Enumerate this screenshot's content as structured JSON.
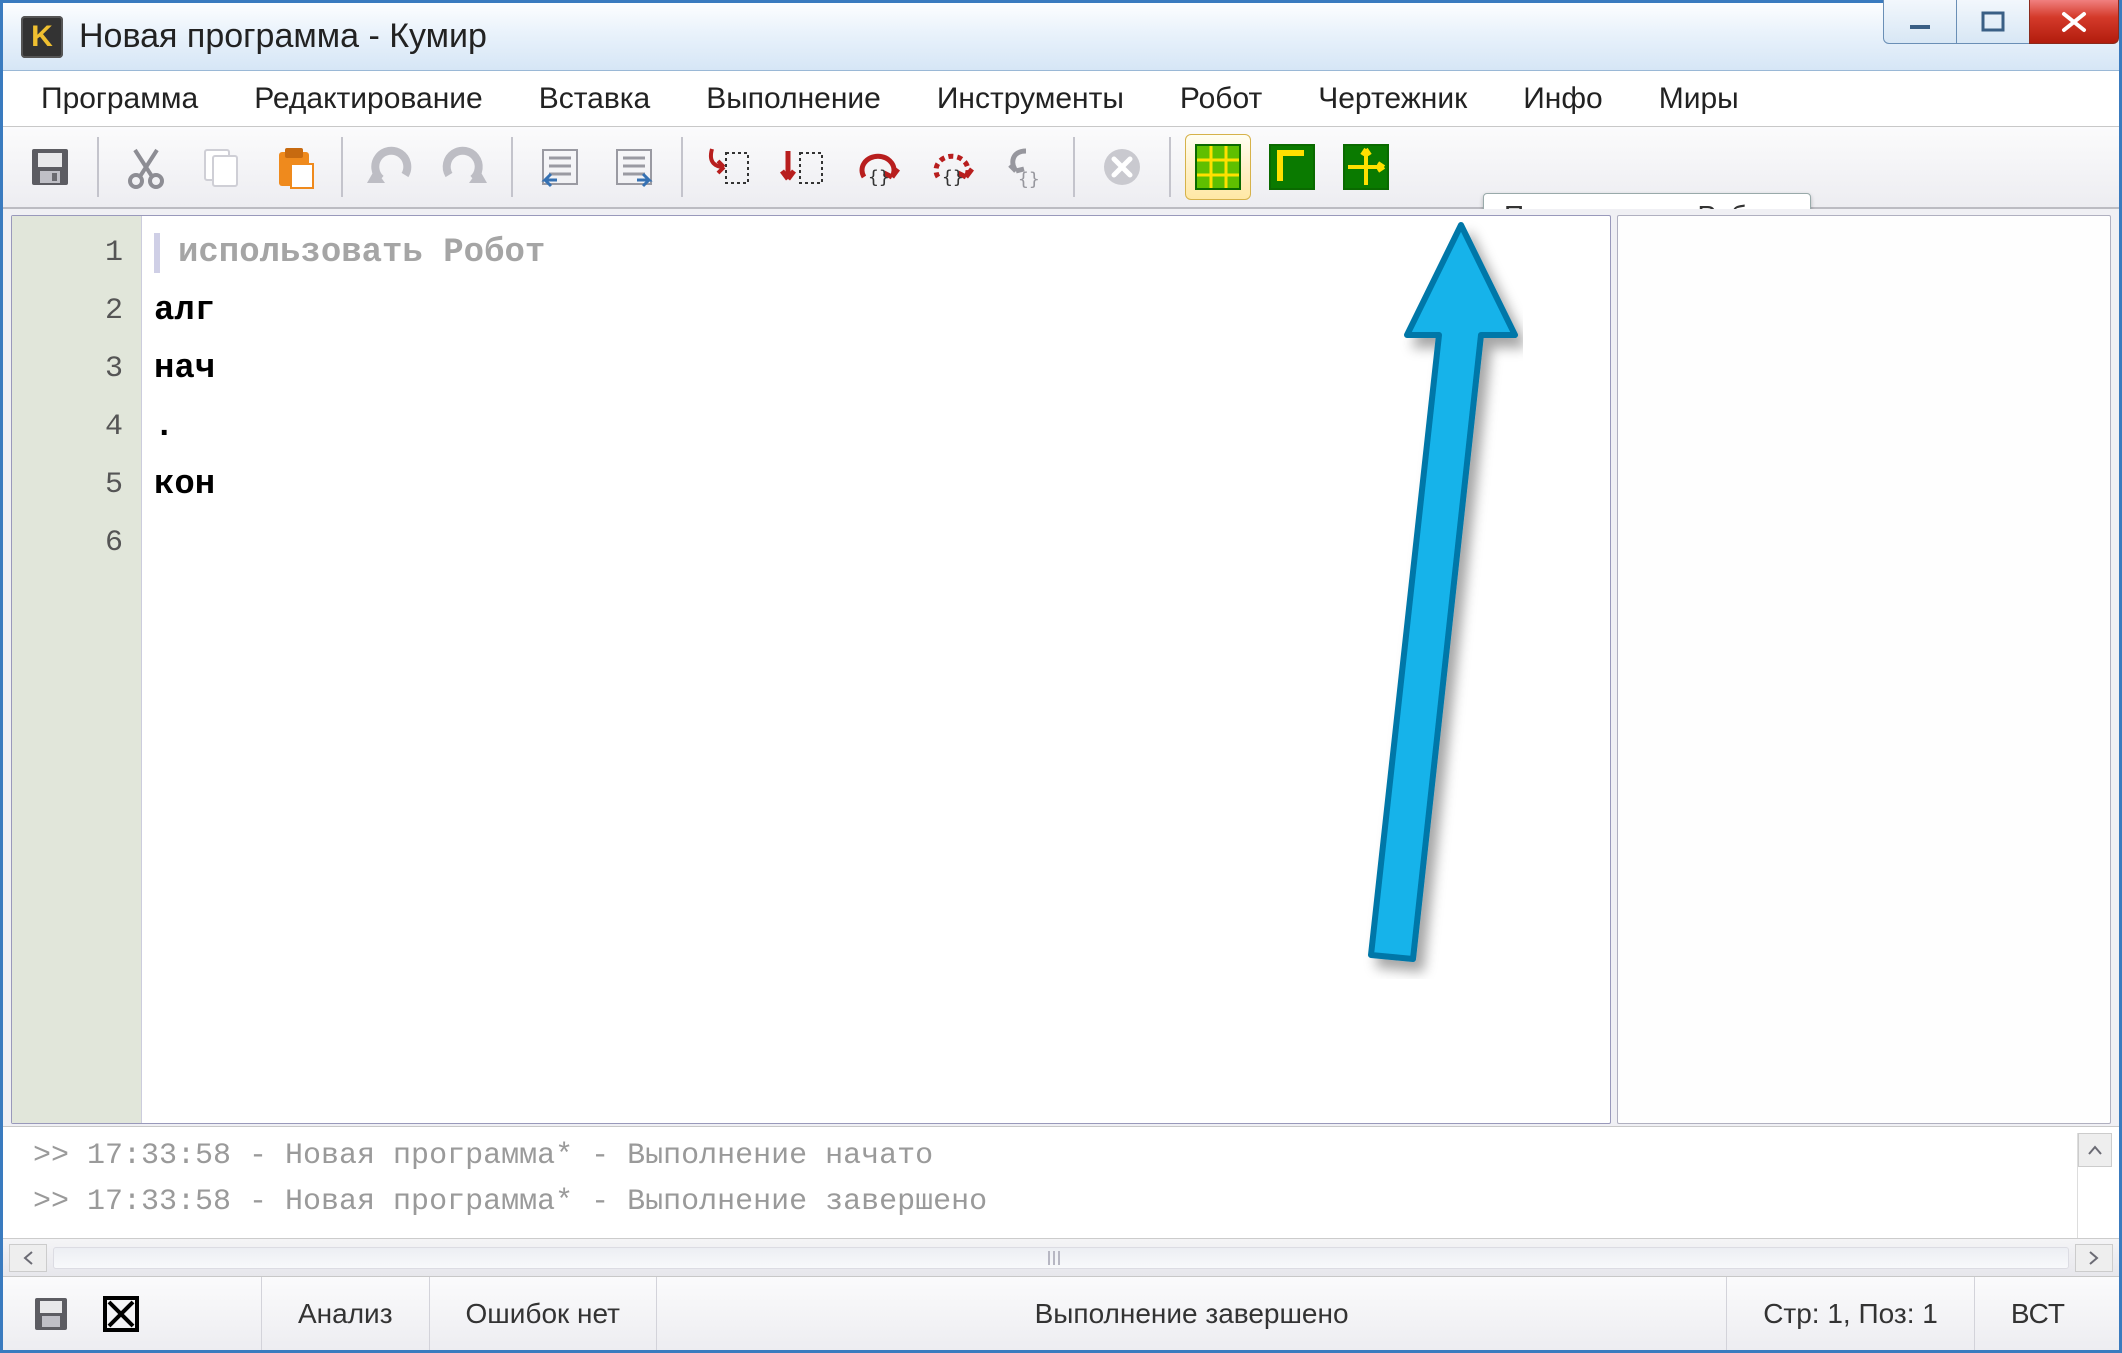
{
  "titlebar": {
    "title": "Новая программа - Кумир",
    "app_badge": "K"
  },
  "menu": {
    "items": [
      "Программа",
      "Редактирование",
      "Вставка",
      "Выполнение",
      "Инструменты",
      "Робот",
      "Чертежник",
      "Инфо",
      "Миры"
    ]
  },
  "toolbar": {
    "buttons": [
      {
        "name": "save-icon"
      },
      {
        "sep": true
      },
      {
        "name": "cut-icon"
      },
      {
        "name": "copy-icon"
      },
      {
        "name": "paste-icon"
      },
      {
        "sep": true
      },
      {
        "name": "undo-icon"
      },
      {
        "name": "redo-icon"
      },
      {
        "sep": true
      },
      {
        "name": "indent-left-icon"
      },
      {
        "name": "indent-right-icon"
      },
      {
        "sep": true
      },
      {
        "name": "run-step-into-icon"
      },
      {
        "name": "run-step-over-icon"
      },
      {
        "name": "run-block-icon"
      },
      {
        "name": "run-small-step-icon"
      },
      {
        "name": "run-to-end-icon"
      },
      {
        "sep": true
      },
      {
        "name": "stop-icon"
      },
      {
        "sep": true
      },
      {
        "name": "show-robot-grid-icon"
      },
      {
        "name": "show-drafter-icon"
      },
      {
        "name": "show-axes-icon"
      }
    ]
  },
  "tooltip": {
    "text": "Показать окно Робота"
  },
  "editor": {
    "lines": [
      {
        "n": "1",
        "type": "comment",
        "text": "использовать Робот"
      },
      {
        "n": "2",
        "type": "kw",
        "text": "алг"
      },
      {
        "n": "3",
        "type": "kw",
        "text": "нач"
      },
      {
        "n": "4",
        "type": "dot",
        "text": "."
      },
      {
        "n": "5",
        "type": "kw",
        "text": "кон"
      },
      {
        "n": "6",
        "type": "blank",
        "text": ""
      }
    ]
  },
  "log": {
    "lines": [
      ">> 17:33:58 - Новая программа* - Выполнение начато",
      ">> 17:33:58 - Новая программа* - Выполнение завершено"
    ]
  },
  "status": {
    "analysis": "Анализ",
    "errors": "Ошибок нет",
    "exec": "Выполнение завершено",
    "pos": "Стр: 1, Поз: 1",
    "ins": "ВСТ"
  }
}
